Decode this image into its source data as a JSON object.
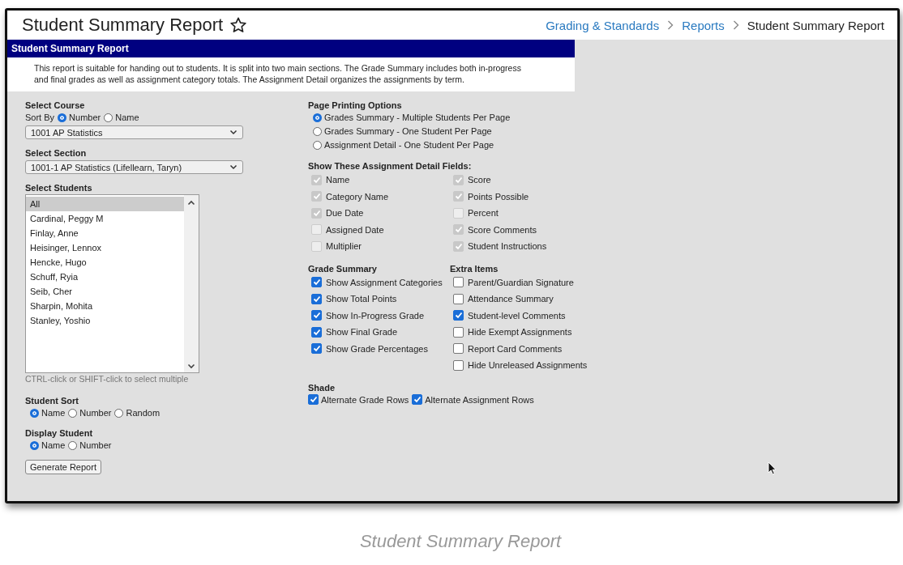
{
  "header": {
    "title": "Student Summary Report",
    "breadcrumbs": [
      {
        "label": "Grading & Standards",
        "link": true
      },
      {
        "label": "Reports",
        "link": true
      },
      {
        "label": "Student Summary Report",
        "link": false
      }
    ]
  },
  "panel": {
    "title": "Student Summary Report",
    "description": "This report is suitable for handing out to students. It is split into two main sections. The Grade Summary includes both in-progress and final grades as well as assignment category totals. The Assignment Detail organizes the assignments by term."
  },
  "course": {
    "label": "Select Course",
    "sort_label": "Sort By",
    "sort_options": [
      {
        "label": "Number",
        "selected": true
      },
      {
        "label": "Name",
        "selected": false
      }
    ],
    "value": "1001 AP Statistics"
  },
  "section": {
    "label": "Select Section",
    "value": "1001-1 AP Statistics (Lifellearn, Taryn)"
  },
  "students": {
    "label": "Select Students",
    "items": [
      {
        "label": "All",
        "selected": true
      },
      {
        "label": "Cardinal, Peggy M",
        "selected": false
      },
      {
        "label": "Finlay, Anne",
        "selected": false
      },
      {
        "label": "Heisinger, Lennox",
        "selected": false
      },
      {
        "label": "Hencke, Hugo",
        "selected": false
      },
      {
        "label": "Schuff, Ryia",
        "selected": false
      },
      {
        "label": "Seib, Cher",
        "selected": false
      },
      {
        "label": "Sharpin, Mohita",
        "selected": false
      },
      {
        "label": "Stanley, Yoshio",
        "selected": false
      }
    ],
    "hint": "CTRL-click or SHIFT-click to select multiple"
  },
  "student_sort": {
    "label": "Student Sort",
    "options": [
      {
        "label": "Name",
        "selected": true
      },
      {
        "label": "Number",
        "selected": false
      },
      {
        "label": "Random",
        "selected": false
      }
    ]
  },
  "display_student": {
    "label": "Display Student",
    "options": [
      {
        "label": "Name",
        "selected": true
      },
      {
        "label": "Number",
        "selected": false
      }
    ]
  },
  "generate_button": "Generate Report",
  "page_printing": {
    "label": "Page Printing Options",
    "options": [
      {
        "label": "Grades Summary - Multiple Students Per Page",
        "selected": true
      },
      {
        "label": "Grades Summary - One Student Per Page",
        "selected": false
      },
      {
        "label": "Assignment Detail - One Student Per Page",
        "selected": false
      }
    ]
  },
  "detail_fields": {
    "label": "Show These Assignment Detail Fields:",
    "columns": [
      [
        {
          "label": "Name",
          "checked": true,
          "disabled": true
        },
        {
          "label": "Category Name",
          "checked": true,
          "disabled": true
        },
        {
          "label": "Due Date",
          "checked": true,
          "disabled": true
        },
        {
          "label": "Assigned Date",
          "checked": false,
          "disabled": true
        },
        {
          "label": "Multiplier",
          "checked": false,
          "disabled": true
        }
      ],
      [
        {
          "label": "Score",
          "checked": true,
          "disabled": true
        },
        {
          "label": "Points Possible",
          "checked": true,
          "disabled": true
        },
        {
          "label": "Percent",
          "checked": false,
          "disabled": true
        },
        {
          "label": "Score Comments",
          "checked": true,
          "disabled": true
        },
        {
          "label": "Student Instructions",
          "checked": true,
          "disabled": true
        }
      ]
    ]
  },
  "grade_summary": {
    "label": "Grade Summary",
    "items": [
      {
        "label": "Show Assignment Categories",
        "checked": true,
        "disabled": false
      },
      {
        "label": "Show Total Points",
        "checked": true,
        "disabled": false
      },
      {
        "label": "Show In-Progress Grade",
        "checked": true,
        "disabled": false
      },
      {
        "label": "Show Final Grade",
        "checked": true,
        "disabled": false
      },
      {
        "label": "Show Grade Percentages",
        "checked": true,
        "disabled": false
      }
    ]
  },
  "extra_items": {
    "label": "Extra Items",
    "items": [
      {
        "label": "Parent/Guardian Signature",
        "checked": false,
        "disabled": false
      },
      {
        "label": "Attendance Summary",
        "checked": false,
        "disabled": false
      },
      {
        "label": "Student-level Comments",
        "checked": true,
        "disabled": false
      },
      {
        "label": "Hide Exempt Assignments",
        "checked": false,
        "disabled": false
      },
      {
        "label": "Report Card Comments",
        "checked": false,
        "disabled": false
      },
      {
        "label": "Hide Unreleased Assignments",
        "checked": false,
        "disabled": false
      }
    ]
  },
  "shade": {
    "label": "Shade",
    "items": [
      {
        "label": "Alternate Grade Rows",
        "checked": true,
        "disabled": false
      },
      {
        "label": "Alternate Assignment Rows",
        "checked": true,
        "disabled": false
      }
    ]
  },
  "caption": "Student Summary Report"
}
